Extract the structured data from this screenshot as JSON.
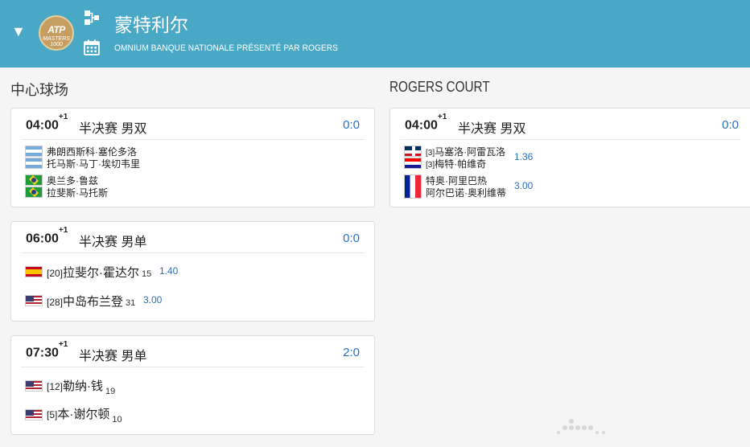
{
  "header": {
    "title": "蒙特利尔",
    "subtitle": "OMNIUM BANQUE NATIONALE PRÉSENTÉ PAR ROGERS",
    "logo_text": "ATP",
    "logo_sub": "MASTERS 1000",
    "color": "#4aa8c7"
  },
  "columns": {
    "left_title": "中心球场",
    "right_title": "ROGERS COURT"
  },
  "matches": [
    {
      "time": "04:00",
      "day_offset": "+1",
      "round": "半决赛 男双",
      "score": "0:0",
      "team1": {
        "players": [
          "弗朗西斯科·塞伦多洛",
          "托马斯·马丁·埃切韦里"
        ],
        "flags": [
          "arg",
          "arg"
        ]
      },
      "team2": {
        "players": [
          "奥兰多·鲁兹",
          "拉斐斯·马托斯"
        ],
        "flags": [
          "bra",
          "bra"
        ]
      }
    },
    {
      "time": "06:00",
      "day_offset": "+1",
      "round": "半决赛 男单",
      "score": "0:0",
      "player1": {
        "seed": "[20]",
        "name": "拉斐尔·霍达尔",
        "rank": "15",
        "odds": "1.40",
        "flag": "esp"
      },
      "player2": {
        "seed": "[28]",
        "name": "中岛布兰登",
        "rank": "31",
        "odds": "3.00",
        "flag": "usa"
      }
    },
    {
      "time": "07:30",
      "day_offset": "+1",
      "round": "半决赛 男单",
      "score": "2:0",
      "player1": {
        "seed": "[12]",
        "name": "勒纳·钱",
        "rank": "19",
        "flag": "usa"
      },
      "player2": {
        "seed": "[5]",
        "name": "本·谢尔顿",
        "rank": "10",
        "flag": "usa"
      }
    },
    {
      "time": "04:00",
      "day_offset": "+1",
      "round": "半决赛 男双",
      "score": "0:0",
      "team1": {
        "seeds": [
          "[3]",
          "[3]"
        ],
        "players": [
          "马塞洛·阿雷瓦洛",
          "梅特·帕维奇"
        ],
        "flags": [
          "dom",
          "cro"
        ],
        "odds": "1.36"
      },
      "team2": {
        "players": [
          "特奥·阿里巴热",
          "阿尔巴诺·奥利维蒂"
        ],
        "flags": [
          "fra"
        ],
        "odds": "3.00"
      }
    }
  ],
  "colors": {
    "accent": "#2b6fbf"
  }
}
